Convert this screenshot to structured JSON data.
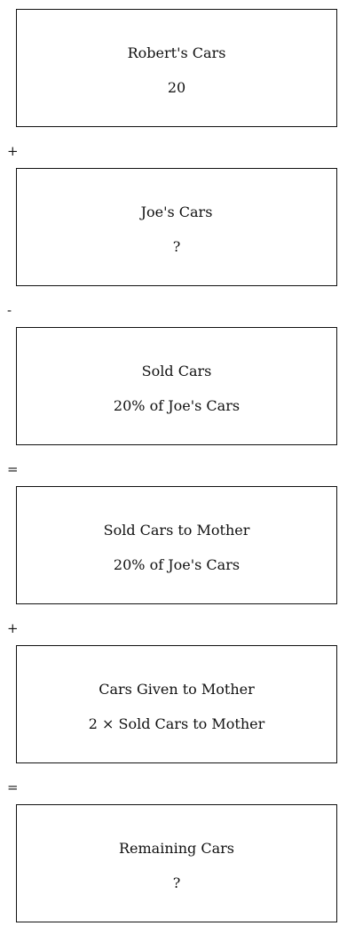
{
  "diagram": {
    "boxes": [
      {
        "title": "Robert's Cars",
        "value": "20"
      },
      {
        "title": "Joe's Cars",
        "value": "?"
      },
      {
        "title": "Sold Cars",
        "value": "20% of Joe's Cars"
      },
      {
        "title": "Sold Cars to Mother",
        "value": "20% of Joe's Cars"
      },
      {
        "title": "Cars Given to Mother",
        "value": "2 × Sold Cars to Mother"
      },
      {
        "title": "Remaining Cars",
        "value": "?"
      }
    ],
    "operators": [
      "+",
      "-",
      "=",
      "+",
      "="
    ]
  }
}
